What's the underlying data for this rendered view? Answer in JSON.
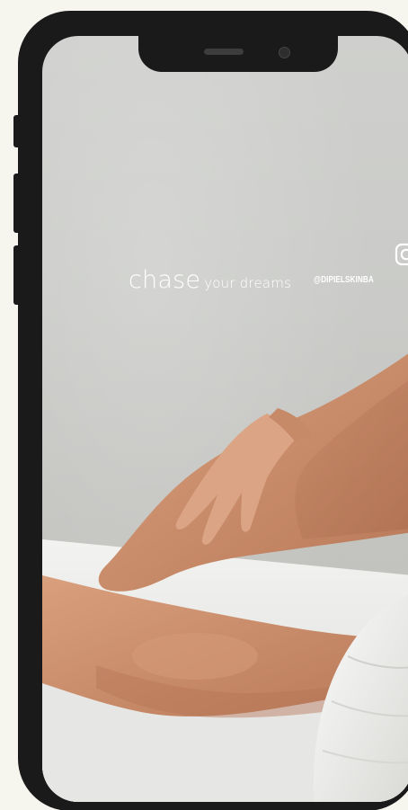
{
  "caption": {
    "big": "chase",
    "small": "your dreams"
  },
  "social": {
    "icon": "instagram-icon",
    "handle": "@DIPIELSKINBA"
  },
  "colors": {
    "background": "#f6f6ee",
    "frame": "#1a1a1a",
    "caption": "#ffffff"
  }
}
